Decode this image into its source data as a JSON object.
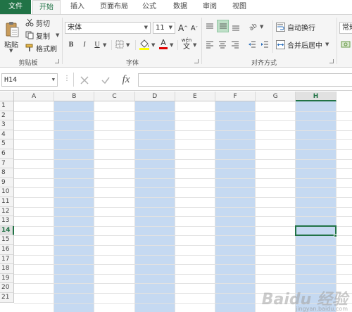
{
  "tabs": [
    "文件",
    "开始",
    "插入",
    "页面布局",
    "公式",
    "数据",
    "审阅",
    "视图"
  ],
  "clipboard": {
    "paste_label": "粘贴",
    "cut_label": "剪切",
    "copy_label": "复制",
    "format_painter_label": "格式刷",
    "group_label": "剪贴板"
  },
  "font": {
    "font_name": "宋体",
    "font_size": "11",
    "grow_label": "A",
    "shrink_label": "A",
    "bold": "B",
    "italic": "I",
    "underline": "U",
    "font_color_label": "A",
    "phonetic_label": "wén",
    "group_label": "字体"
  },
  "alignment": {
    "wrap_text_label": "自动换行",
    "merge_center_label": "合并后居中",
    "group_label": "对齐方式"
  },
  "number": {
    "format_label": "常规"
  },
  "formula_bar": {
    "name_box": "H14",
    "fx_label": "fx"
  },
  "columns": [
    "A",
    "B",
    "C",
    "D",
    "E",
    "F",
    "G",
    "H"
  ],
  "rows": [
    "1",
    "2",
    "3",
    "4",
    "5",
    "6",
    "7",
    "8",
    "9",
    "10",
    "11",
    "12",
    "13",
    "14",
    "15",
    "16",
    "17",
    "18",
    "19",
    "20",
    "21"
  ],
  "selected_column": "H",
  "selected_row": "14",
  "watermark": {
    "text": "Baidu 经验",
    "sub": "jingyan.baidu.com"
  },
  "colors": {
    "accent": "#217346",
    "column_fill": "#c5d9f1"
  }
}
